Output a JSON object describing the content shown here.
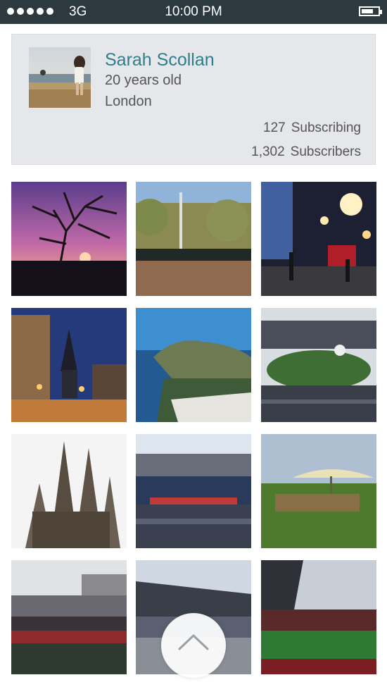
{
  "status_bar": {
    "signal_dots": 5,
    "carrier": "3G",
    "time": "10:00 PM",
    "battery_level": 0.75,
    "battery_icon": "battery-icon"
  },
  "profile": {
    "name": "Sarah Scollan",
    "age": "20 years old",
    "location": "London",
    "subscribing_count": "127",
    "subscribing_label": "Subscribing",
    "subscribers_count": "1,302",
    "subscribers_label": "Subscribers",
    "accent_color": "#2e7f8c"
  },
  "photos": [
    {
      "subject": "sunset-tree"
    },
    {
      "subject": "guards-parade"
    },
    {
      "subject": "night-street"
    },
    {
      "subject": "town-church-street"
    },
    {
      "subject": "island-coast"
    },
    {
      "subject": "stadium-ceremony"
    },
    {
      "subject": "sagrada-familia"
    },
    {
      "subject": "olympic-stadium"
    },
    {
      "subject": "garden-umbrella"
    },
    {
      "subject": "street-crowd"
    },
    {
      "subject": "stadium-roof"
    },
    {
      "subject": "stadium-pitch"
    }
  ],
  "scroll_top_icon": "chevron-up-icon"
}
